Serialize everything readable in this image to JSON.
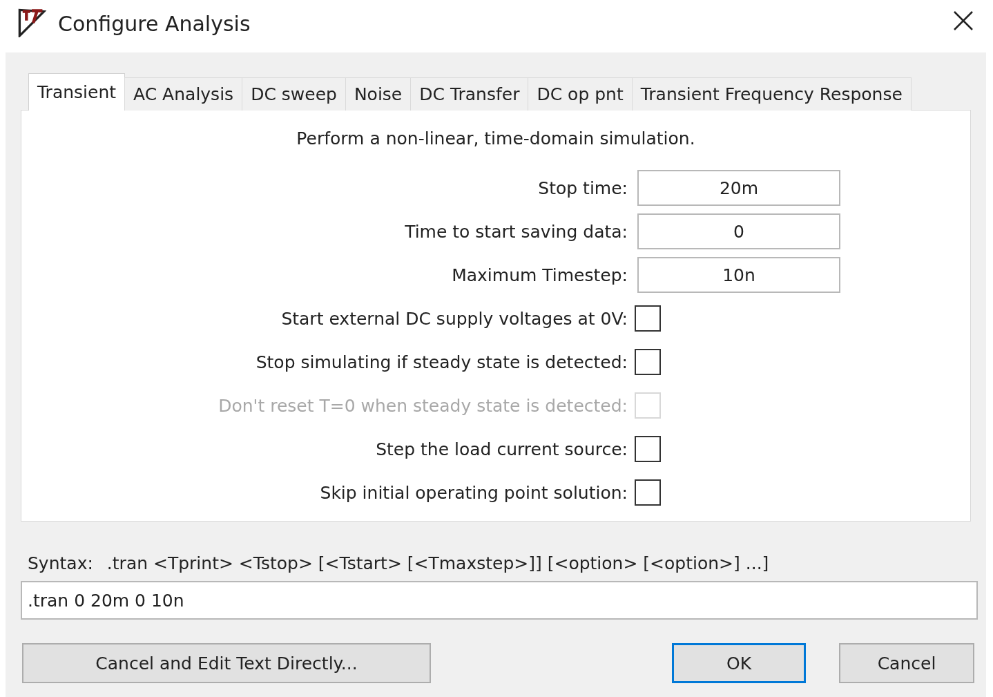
{
  "window": {
    "title": "Configure Analysis"
  },
  "tabs": [
    {
      "label": "Transient",
      "selected": true
    },
    {
      "label": "AC Analysis",
      "selected": false
    },
    {
      "label": "DC sweep",
      "selected": false
    },
    {
      "label": "Noise",
      "selected": false
    },
    {
      "label": "DC Transfer",
      "selected": false
    },
    {
      "label": "DC op pnt",
      "selected": false
    },
    {
      "label": "Transient Frequency Response",
      "selected": false
    }
  ],
  "description": "Perform a non-linear, time-domain simulation.",
  "fields": [
    {
      "label": "Stop time:",
      "value": "20m"
    },
    {
      "label": "Time to start saving data:",
      "value": "0"
    },
    {
      "label": "Maximum Timestep:",
      "value": "10n"
    }
  ],
  "options": [
    {
      "label": "Start external DC supply voltages at 0V:",
      "checked": false,
      "disabled": false
    },
    {
      "label": "Stop simulating if steady state is detected:",
      "checked": false,
      "disabled": false
    },
    {
      "label": "Don't reset T=0 when steady state is detected:",
      "checked": false,
      "disabled": true
    },
    {
      "label": "Step the load current source:",
      "checked": false,
      "disabled": false
    },
    {
      "label": "Skip initial operating point solution:",
      "checked": false,
      "disabled": false
    }
  ],
  "syntax": {
    "label": "Syntax:",
    "text": ".tran <Tprint> <Tstop> [<Tstart> [<Tmaxstep>]] [<option> [<option>] ...]"
  },
  "command": {
    "value": ".tran 0 20m 0 10n"
  },
  "buttons": [
    {
      "label": "Cancel and Edit Text Directly...",
      "default": false
    },
    {
      "label": "OK",
      "default": true
    },
    {
      "label": "Cancel",
      "default": false
    }
  ]
}
